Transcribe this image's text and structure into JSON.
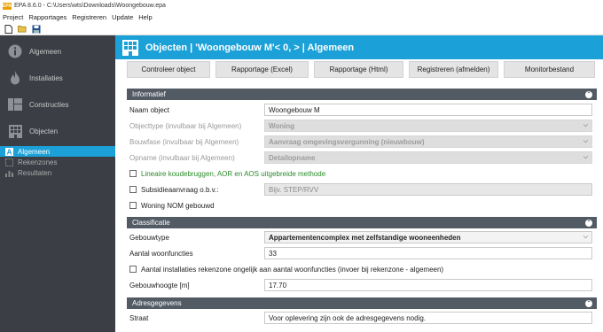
{
  "window": {
    "title": "EPA 8.6.0 - C:\\Users\\wts\\Downloads\\Woongebouw.epa",
    "app_icon_text": "EPA"
  },
  "menu": [
    "Project",
    "Rapportages",
    "Registreren",
    "Update",
    "Help"
  ],
  "toolbar": [
    {
      "name": "new-icon",
      "glyph": "🗋"
    },
    {
      "name": "open-icon",
      "glyph": "📂"
    },
    {
      "name": "save-icon",
      "glyph": "💾"
    }
  ],
  "sidebar": {
    "items": [
      {
        "label": "Algemeen",
        "icon": "info-icon"
      },
      {
        "label": "Installaties",
        "icon": "flame-icon"
      },
      {
        "label": "Constructies",
        "icon": "wall-icon"
      },
      {
        "label": "Objecten",
        "icon": "building-icon"
      }
    ],
    "subitems": [
      {
        "label": "Algemeen",
        "icon": "letter-a-icon",
        "active": true
      },
      {
        "label": "Rekenzones",
        "icon": "zones-icon",
        "active": false
      },
      {
        "label": "Resultaten",
        "icon": "bars-icon",
        "active": false
      }
    ]
  },
  "header": {
    "title": "Objecten | 'Woongebouw M'< 0,  > | Algemeen"
  },
  "buttons": [
    "Controleer object",
    "Rapportage (Excel)",
    "Rapportage (Html)",
    "Registreren (afmelden)",
    "Monitorbestand"
  ],
  "sections": {
    "informatief": {
      "title": "Informatief",
      "naam_label": "Naam object",
      "naam_value": "Woongebouw M",
      "objecttype_label": "Objecttype (invulbaar bij Algemeen)",
      "objecttype_value": "Woning",
      "bouwfase_label": "Bouwfase (invulbaar bij Algemeen)",
      "bouwfase_value": "Aanvraag omgevingsvergunning (nieuwbouw)",
      "opname_label": "Opname (invulbaar bij Algemeen)",
      "opname_value": "Detailopname",
      "lineaire_label": "Lineaire koudebruggen, AOR en AOS uitgebreide methode",
      "subsidie_label": "Subsidieaanvraag o.b.v.:",
      "subsidie_placeholder": "Bijv. STEP/RVV",
      "nom_label": "Woning NOM gebouwd"
    },
    "classificatie": {
      "title": "Classificatie",
      "gebouwtype_label": "Gebouwtype",
      "gebouwtype_value": "Appartementencomplex met zelfstandige wooneenheden",
      "aantal_label": "Aantal woonfuncties",
      "aantal_value": "33",
      "installaties_label": "Aantal installaties rekenzone ongelijk aan aantal woonfuncties (invoer bij rekenzone - algemeen)",
      "hoogte_label": "Gebouwhoogte [m]",
      "hoogte_value": "17.70"
    },
    "adres": {
      "title": "Adresgegevens",
      "straat_label": "Straat",
      "straat_value": "Voor oplevering zijn ook de adresgegevens nodig."
    }
  }
}
